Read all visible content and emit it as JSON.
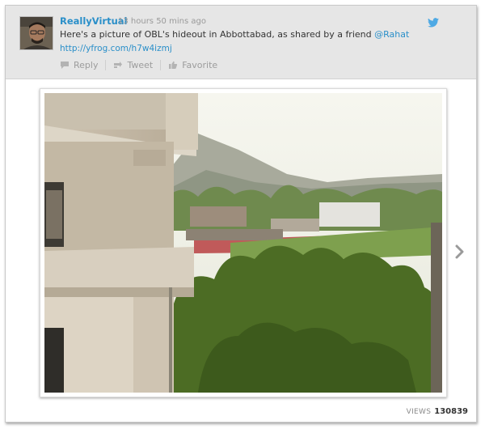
{
  "tweet": {
    "username": "ReallyVirtual",
    "timestamp": "13 hours 50 mins ago",
    "text": "Here's a picture of OBL's hideout in Abbottabad, as shared by a friend ",
    "mention": "@Rahat",
    "link": "http://yfrog.com/h7w4izmj"
  },
  "actions": {
    "reply_label": "Reply",
    "retweet_label": "Tweet",
    "favorite_label": "Favorite"
  },
  "icons": {
    "brand": "twitter-bird-icon",
    "reply": "reply-icon",
    "retweet": "retweet-icon",
    "favorite": "favorite-icon",
    "next": "chevron-right-icon"
  },
  "stats": {
    "views_label": "VIEWS",
    "views_count": "130839"
  },
  "colors": {
    "link_blue": "#2a8fc9",
    "header_bg": "#e6e6e6",
    "muted_text": "#9c9c9c"
  }
}
